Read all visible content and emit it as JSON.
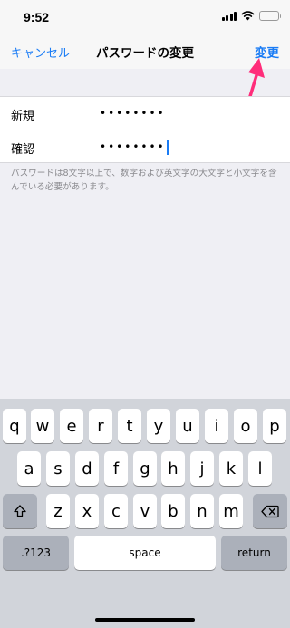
{
  "status_bar": {
    "time": "9:52",
    "icons": [
      "signal-icon",
      "wifi-icon",
      "battery-icon"
    ]
  },
  "nav": {
    "cancel_label": "キャンセル",
    "title": "パスワードの変更",
    "change_label": "変更"
  },
  "form": {
    "rows": [
      {
        "label": "新規",
        "value": "••••••••"
      },
      {
        "label": "確認",
        "value": "••••••••"
      }
    ],
    "hint": "パスワードは8文字以上で、数字および英文字の大文字と小文字を含んでいる必要があります。"
  },
  "keyboard": {
    "row1": [
      "q",
      "w",
      "e",
      "r",
      "t",
      "y",
      "u",
      "i",
      "o",
      "p"
    ],
    "row2": [
      "a",
      "s",
      "d",
      "f",
      "g",
      "h",
      "j",
      "k",
      "l"
    ],
    "row3": [
      "z",
      "x",
      "c",
      "v",
      "b",
      "n",
      "m"
    ],
    "numbers_label": ".?123",
    "space_label": "space",
    "return_label": "return",
    "shift_icon": "shift-icon",
    "delete_icon": "delete-icon"
  },
  "colors": {
    "accent": "#1a7cf5",
    "annotation_arrow": "#ff2d7a"
  }
}
